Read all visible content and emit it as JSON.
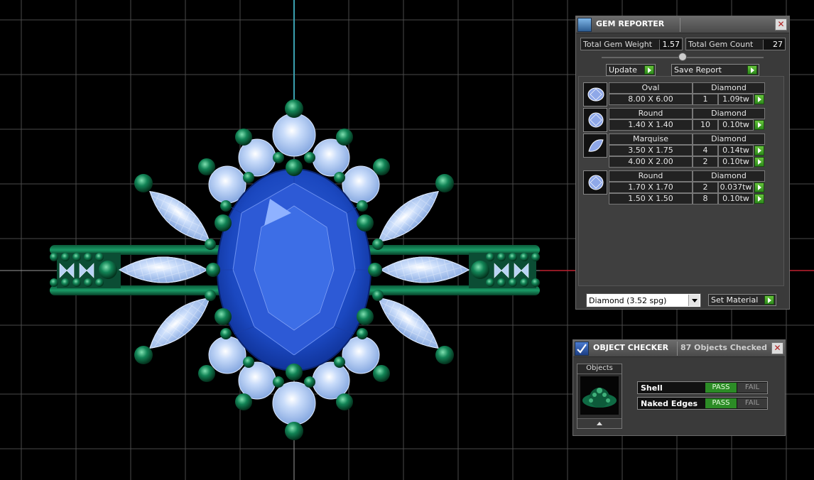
{
  "gem_reporter": {
    "title": "GEM REPORTER",
    "total_weight_label": "Total Gem Weight",
    "total_weight_value": "1.57",
    "total_count_label": "Total Gem Count",
    "total_count_value": "27",
    "update_label": "Update",
    "save_report_label": "Save Report",
    "gems": [
      {
        "shape": "Oval",
        "material": "Diamond",
        "sizes": [
          {
            "size": "8.00 X 6.00",
            "qty": "1",
            "weight": "1.09tw"
          }
        ]
      },
      {
        "shape": "Round",
        "material": "Diamond",
        "sizes": [
          {
            "size": "1.40 X 1.40",
            "qty": "10",
            "weight": "0.10tw"
          }
        ]
      },
      {
        "shape": "Marquise",
        "material": "Diamond",
        "sizes": [
          {
            "size": "3.50 X 1.75",
            "qty": "4",
            "weight": "0.14tw"
          },
          {
            "size": "4.00 X 2.00",
            "qty": "2",
            "weight": "0.10tw"
          }
        ]
      },
      {
        "shape": "Round",
        "material": "Diamond",
        "sizes": [
          {
            "size": "1.70 X 1.70",
            "qty": "2",
            "weight": "0.037tw"
          },
          {
            "size": "1.50 X 1.50",
            "qty": "8",
            "weight": "0.10tw"
          }
        ]
      }
    ],
    "material_select": "Diamond    (3.52 spg)",
    "set_material_label": "Set Material"
  },
  "object_checker": {
    "title": "OBJECT CHECKER",
    "status": "87  Objects Checked",
    "objects_label": "Objects",
    "checks": [
      {
        "label": "Shell",
        "pass": "PASS",
        "fail": "FAIL"
      },
      {
        "label": "Naked Edges",
        "pass": "PASS",
        "fail": "FAIL"
      }
    ]
  },
  "colors": {
    "background": "#000000",
    "grid": "#5a5a5a",
    "prong_green": "#0f7a4e",
    "center_stone": "#1f4fc8",
    "side_stones": "#a9c8f0",
    "panel": "#3a3a3a",
    "pass_green": "#2c8c26"
  },
  "icons": [
    "gem-reporter-icon",
    "close-icon",
    "checkmark-icon",
    "oval-gem-icon",
    "round-gem-icon",
    "marquise-gem-icon",
    "ring-thumbnail-icon",
    "up-arrow-icon"
  ]
}
